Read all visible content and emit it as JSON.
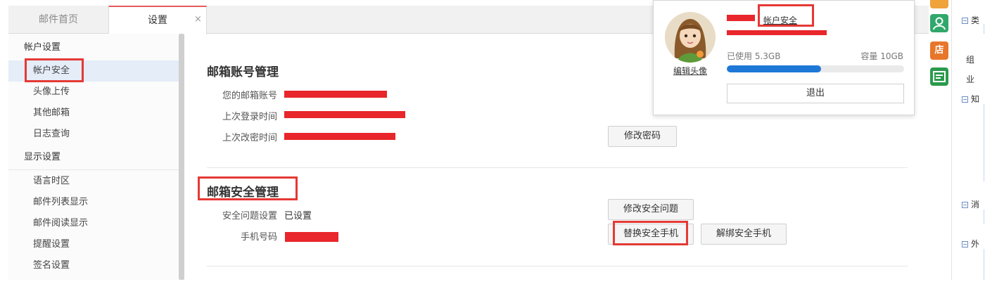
{
  "tabs": [
    {
      "label": "邮件首页",
      "active": false
    },
    {
      "label": "设置",
      "active": true
    }
  ],
  "tab_close": "×",
  "sidebar": {
    "groups": [
      {
        "header": "帐户设置",
        "items": [
          "帐户安全",
          "头像上传",
          "其他邮箱",
          "日志查询"
        ]
      },
      {
        "header": "显示设置",
        "items": [
          "语言时区",
          "邮件列表显示",
          "邮件阅读显示",
          "提醒设置",
          "签名设置"
        ]
      }
    ],
    "active_item": "帐户安全"
  },
  "account_section": {
    "title": "邮箱账号管理",
    "rows": [
      {
        "label": "您的邮箱账号"
      },
      {
        "label": "上次登录时间"
      },
      {
        "label": "上次改密时间"
      }
    ],
    "change_password_button": "修改密码"
  },
  "security_section": {
    "title": "邮箱安全管理",
    "question_label": "安全问题设置",
    "question_value": "已设置",
    "phone_label": "手机号码",
    "change_question_button": "修改安全问题",
    "replace_phone_button": "替换安全手机",
    "unbind_phone_button": "解绑安全手机"
  },
  "popup": {
    "account_security_link": "帐户安全",
    "edit_avatar": "编辑头像",
    "used": "已使用 5.3GB",
    "capacity": "容量 10GB",
    "usage_fraction": 0.53,
    "logout": "退出"
  },
  "right_tools": [
    {
      "icon": "contacts-icon",
      "color": "#31a86b"
    },
    {
      "icon": "store-icon",
      "color": "#e8762a",
      "text": "店"
    },
    {
      "icon": "card-icon",
      "color": "#2c9a4c"
    }
  ],
  "right_panel": {
    "items": [
      "类",
      "组",
      "业",
      "知",
      "消",
      "外"
    ]
  },
  "colors": {
    "highlight": "#e53935",
    "redaction": "#e8262b",
    "active_bg": "#e4edf8",
    "progress": "#1e78d7"
  }
}
